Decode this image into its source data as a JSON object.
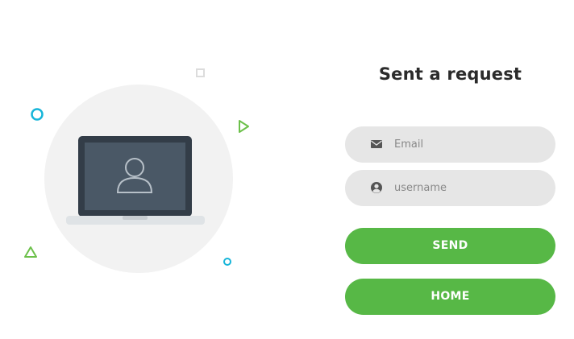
{
  "form": {
    "title": "Sent a request",
    "email_placeholder": "Email",
    "username_placeholder": "username",
    "send_label": "SEND",
    "home_label": "HOME"
  },
  "icons": {
    "email": "envelope-icon",
    "username": "user-circle-icon",
    "illustration": "laptop-user-icon"
  },
  "colors": {
    "accent": "#57b846",
    "field_bg": "#e6e6e6",
    "circle_bg": "#f2f2f2",
    "screen": "#4a5866",
    "laptop_frame": "#333d48",
    "decor_cyan": "#17b5d9",
    "decor_green": "#6cc04a",
    "decor_gray": "#dcdcdc",
    "title": "#2b2b2b"
  }
}
